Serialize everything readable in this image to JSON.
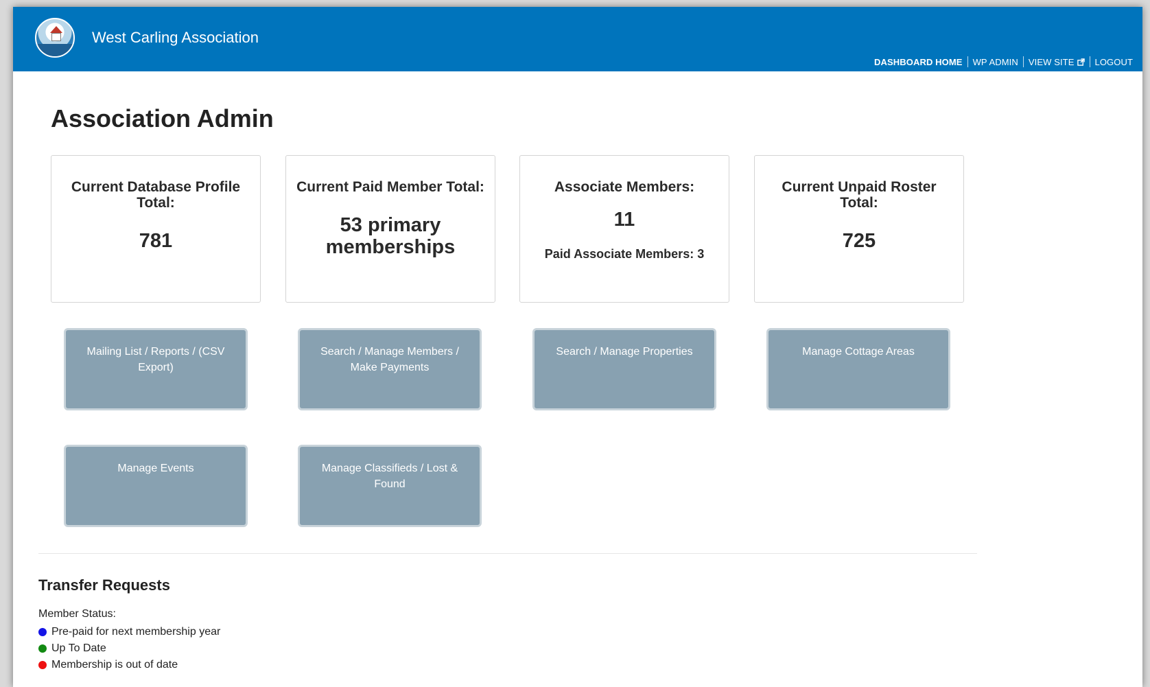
{
  "header": {
    "site_title": "West Carling Association",
    "nav": [
      {
        "label": "DASHBOARD HOME"
      },
      {
        "label": "WP ADMIN"
      },
      {
        "label": "VIEW SITE"
      },
      {
        "label": "LOGOUT"
      }
    ],
    "brand_color": "#0074bc"
  },
  "page_title": "Association Admin",
  "stats": [
    {
      "label": "Current Database Profile Total:",
      "value": "781"
    },
    {
      "label": "Current Paid Member Total:",
      "value": "53 primary memberships"
    },
    {
      "label": "Associate Members:",
      "value": "11",
      "sub": "Paid Associate Members: 3"
    },
    {
      "label": "Current Unpaid Roster Total:",
      "value": "725"
    }
  ],
  "actions": [
    {
      "label": "Mailing List / Reports / (CSV Export)"
    },
    {
      "label": "Search / Manage Members / Make Payments"
    },
    {
      "label": "Search / Manage Properties"
    },
    {
      "label": "Manage Cottage Areas"
    },
    {
      "label": "Manage Events"
    },
    {
      "label": "Manage Classifieds / Lost & Found"
    }
  ],
  "transfer": {
    "title": "Transfer Requests",
    "status_label": "Member Status:",
    "legend": [
      {
        "label": "Pre-paid for next membership year",
        "color": "#1414e6"
      },
      {
        "label": "Up To Date",
        "color": "#128a12"
      },
      {
        "label": "Membership is out of date",
        "color": "#ee1111"
      }
    ]
  }
}
